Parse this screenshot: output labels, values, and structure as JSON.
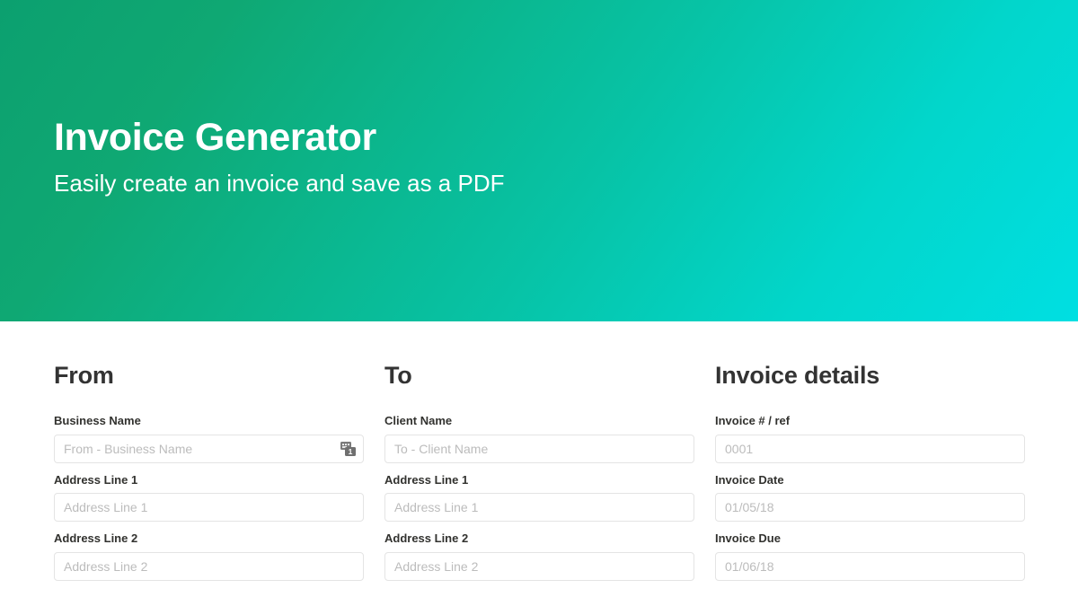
{
  "hero": {
    "title": "Invoice Generator",
    "subtitle": "Easily create an invoice and save as a PDF",
    "gradient_start": "#0ca06f",
    "gradient_end": "#00dfe2"
  },
  "colors": {
    "heading": "#333333",
    "label": "#32322f",
    "placeholder": "#bcbcbc",
    "input_border": "#e4e4e4",
    "page_background": "#ffffff"
  },
  "columns": [
    {
      "heading": "From",
      "fields": [
        {
          "label": "Business Name",
          "placeholder": "From - Business Name",
          "value": "",
          "has_autofill_badge": true,
          "badge_count": "1"
        },
        {
          "label": "Address Line 1",
          "placeholder": "Address Line 1",
          "value": "",
          "has_autofill_badge": false
        },
        {
          "label": "Address Line 2",
          "placeholder": "Address Line 2",
          "value": "",
          "has_autofill_badge": false
        }
      ]
    },
    {
      "heading": "To",
      "fields": [
        {
          "label": "Client Name",
          "placeholder": "To - Client Name",
          "value": "",
          "has_autofill_badge": false
        },
        {
          "label": "Address Line 1",
          "placeholder": "Address Line 1",
          "value": "",
          "has_autofill_badge": false
        },
        {
          "label": "Address Line 2",
          "placeholder": "Address Line 2",
          "value": "",
          "has_autofill_badge": false
        }
      ]
    },
    {
      "heading": "Invoice details",
      "fields": [
        {
          "label": "Invoice # / ref",
          "placeholder": "0001",
          "value": "",
          "has_autofill_badge": false
        },
        {
          "label": "Invoice Date",
          "placeholder": "01/05/18",
          "value": "",
          "has_autofill_badge": false
        },
        {
          "label": "Invoice Due",
          "placeholder": "01/06/18",
          "value": "",
          "has_autofill_badge": false
        }
      ]
    }
  ]
}
